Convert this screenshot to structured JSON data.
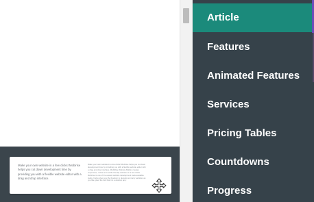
{
  "preview": {
    "card": {
      "left_text": "Make your own website in a few clicks! Mobirise helps you cut down development time by providing you with a flexible website editor with a drag and drop interface.",
      "right_text": "Make your own website in a few clicks! Mobirise helps you cut down development time by providing you with a flexible website editor with a drag and drop interface. MobiRise Website Builder creates responsive, retina and mobile friendly websites in a few clicks. Mobirise is one of the easiest website development tools available today. It also gives you the freedom to develop as many websites as you like given the fact that it is a desktop app."
    }
  },
  "menu": {
    "items": [
      {
        "label": "Article",
        "active": true
      },
      {
        "label": "Features",
        "active": false
      },
      {
        "label": "Animated Features",
        "active": false
      },
      {
        "label": "Services",
        "active": false
      },
      {
        "label": "Pricing Tables",
        "active": false
      },
      {
        "label": "Countdowns",
        "active": false
      },
      {
        "label": "Progress",
        "active": false
      }
    ]
  },
  "colors": {
    "menu_bg": "#36424a",
    "active_bg": "#1b8a7b",
    "dark_section_bg": "#3b454c",
    "accent": "#6b4db8"
  },
  "icons": {
    "move": "move-arrows-icon"
  }
}
